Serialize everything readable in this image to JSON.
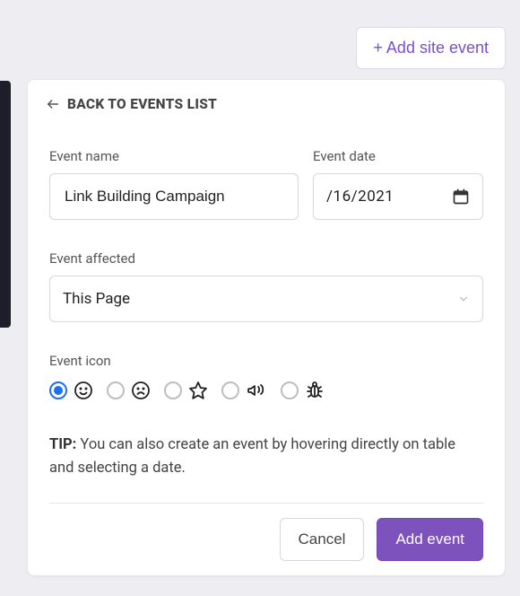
{
  "header": {
    "add_site_event": "+ Add site event"
  },
  "back_label": "BACK TO EVENTS LIST",
  "form": {
    "name_label": "Event name",
    "name_value": "Link Building Campaign",
    "date_label": "Event date",
    "date_value": "/16/2021",
    "affected_label": "Event affected",
    "affected_value": "This Page",
    "icon_label": "Event icon",
    "icon_options": [
      {
        "key": "smile",
        "selected": true
      },
      {
        "key": "frown",
        "selected": false
      },
      {
        "key": "star",
        "selected": false
      },
      {
        "key": "megaphone",
        "selected": false
      },
      {
        "key": "bug",
        "selected": false
      }
    ],
    "tip_prefix": "TIP:",
    "tip_text": " You can also create an event by hovering directly on table and selecting a date."
  },
  "actions": {
    "cancel": "Cancel",
    "submit": "Add event"
  }
}
